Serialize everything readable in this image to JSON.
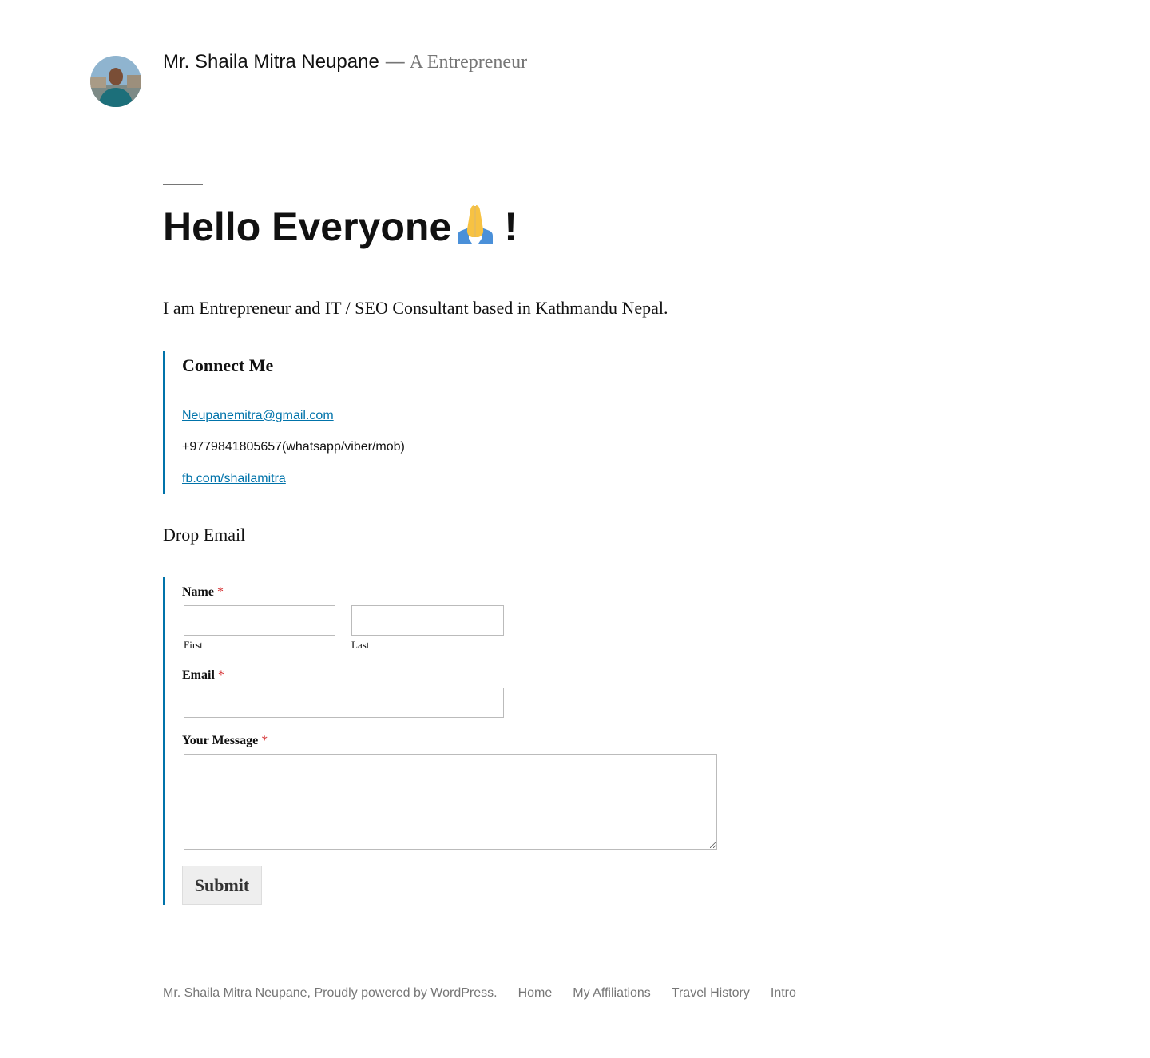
{
  "header": {
    "site_title": "Mr. Shaila Mitra Neupane",
    "separator": "—",
    "description": "A Entrepreneur"
  },
  "main": {
    "title": "Hello Everyone",
    "title_suffix": "!",
    "intro": "I am Entrepreneur and IT / SEO Consultant based in Kathmandu Nepal."
  },
  "connect": {
    "heading": "Connect Me",
    "email": "Neupanemitra@gmail.com",
    "phone": "+9779841805657(whatsapp/viber/mob)",
    "facebook": "fb.com/shailamitra"
  },
  "form": {
    "section_title": "Drop Email",
    "name_label": "Name",
    "required_mark": "*",
    "first_sublabel": "First",
    "last_sublabel": "Last",
    "email_label": "Email",
    "message_label": "Your Message",
    "submit_label": "Submit"
  },
  "footer": {
    "powered_site": "Mr. Shaila Mitra Neupane,",
    "powered_text": "Proudly powered by WordPress.",
    "menu": [
      "Home",
      "My Affiliations",
      "Travel History",
      "Intro"
    ]
  },
  "colors": {
    "link": "#0073aa",
    "secondary_text": "#767676",
    "required": "#d63638"
  },
  "icons": {
    "title_emoji": "folded-hands-icon"
  }
}
